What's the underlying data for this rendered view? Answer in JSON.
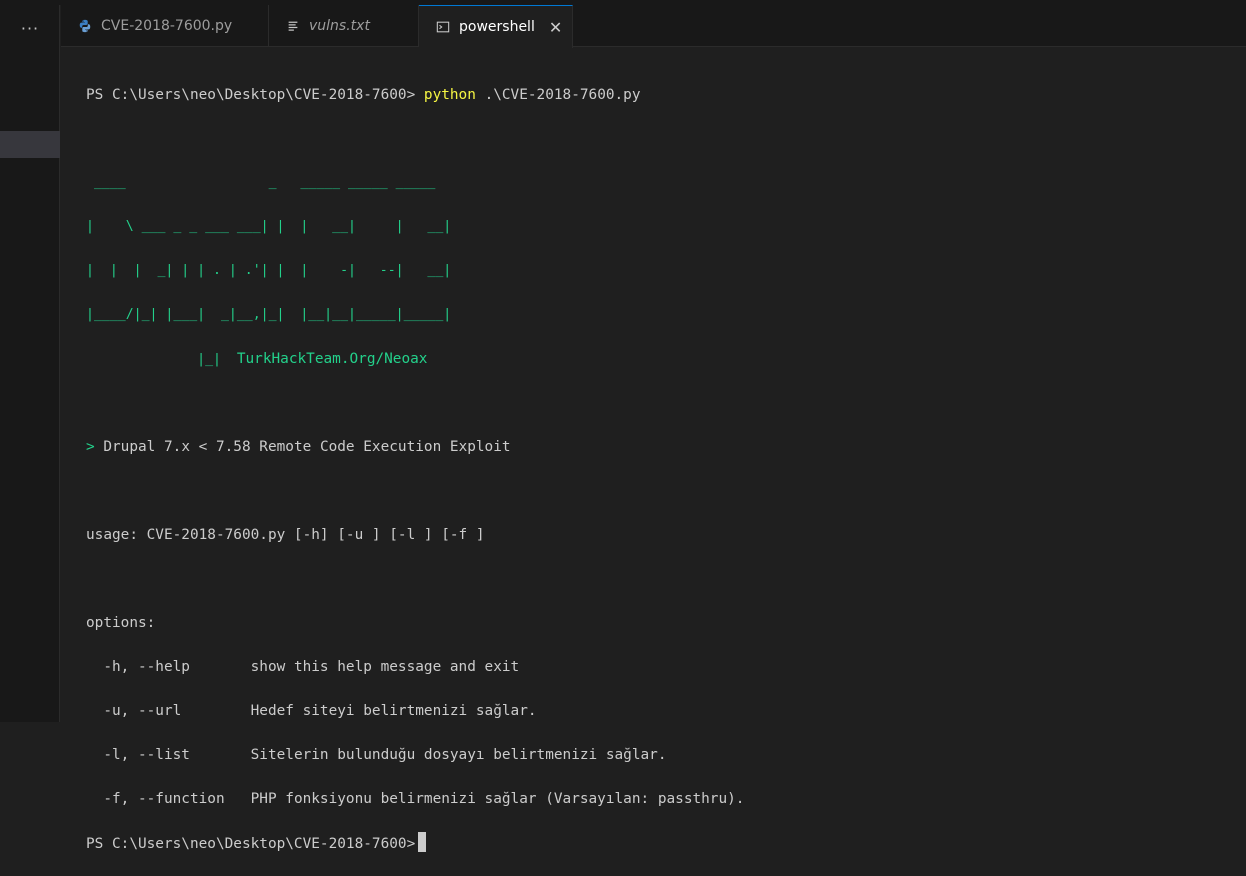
{
  "activity_bar": {
    "more_label": "···"
  },
  "tabs": [
    {
      "label": "CVE-2018-7600.py",
      "icon": "python-icon"
    },
    {
      "label": "vulns.txt",
      "icon": "text-file-icon"
    },
    {
      "label": "powershell",
      "icon": "terminal-icon",
      "active": true,
      "close": "✕"
    }
  ],
  "terminal": {
    "prompt": "PS C:\\Users\\neo\\Desktop\\CVE-2018-7600>",
    "command_name": "python",
    "command_arg": ".\\CVE-2018-7600.py",
    "banner_lines": [
      " ____                  _   _____ _____ _____ ",
      "|    \\ ___ _ _ ___ ___| |  |   __|     |   __|",
      "|  |  |  _| | | . | .'| |  |    -|   --|   __|",
      "|____/|_| |___|  _|__,|_|  |__|__|_____|_____|",
      "              |_|  "
    ],
    "banner_credit": "TurkHackTeam.Org/Neoax",
    "arrow": ">",
    "title": "Drupal 7.x < 7.58 Remote Code Execution Exploit",
    "usage": "usage: CVE-2018-7600.py [-h] [-u ] [-l ] [-f ]",
    "options_header": "options:",
    "options": [
      {
        "flag": "  -h, --help       ",
        "desc": "show this help message and exit"
      },
      {
        "flag": "  -u, --url        ",
        "desc": "Hedef siteyi belirtmenizi sağlar."
      },
      {
        "flag": "  -l, --list       ",
        "desc": "Sitelerin bulunduğu dosyayı belirtmenizi sağlar."
      },
      {
        "flag": "  -f, --function   ",
        "desc": "PHP fonksiyonu belirmenizi sağlar (Varsayılan: passthru)."
      }
    ],
    "final_prompt": "PS C:\\Users\\neo\\Desktop\\CVE-2018-7600>"
  },
  "colors": {
    "accent": "#0078d4",
    "ansi_green": "#23d18b",
    "ansi_yellow": "#f5f543",
    "background": "#1f1f1f"
  }
}
